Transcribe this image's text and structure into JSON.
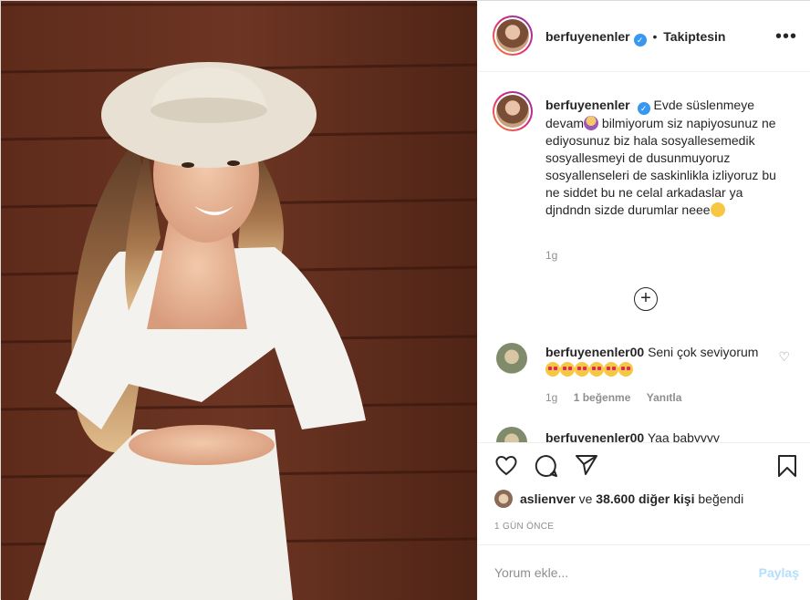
{
  "post": {
    "username": "berfuyenenler",
    "follow_status": "Takiptesin",
    "separator": "•",
    "more_icon": "more-horizontal-icon",
    "caption_parts": [
      "Evde süslenmeye devam",
      " bilmiyorum siz napiyosunuz ne ediyosunuz biz hala sosyallesemedik sosyallesmeyi de dusunmuyoruz sosyallenseleri de saskinlikla izliyoruz bu ne siddet bu ne celal arkadaslar ya djndndn sizde durumlar neee"
    ],
    "caption_time": "1g",
    "load_more_icon": "plus-circle-icon"
  },
  "comments": [
    {
      "username": "berfuyenenler00",
      "text": "Seni çok seviyorum",
      "time": "1g",
      "likes": "1 beğenme",
      "reply": "Yanıtla"
    },
    {
      "username": "berfuyenenler00",
      "text": "Yaa babyyyy"
    }
  ],
  "actions": {
    "like_icon": "heart-icon",
    "comment_icon": "comment-icon",
    "share_icon": "share-icon",
    "save_icon": "bookmark-icon"
  },
  "likes_line": {
    "user": "aslienver",
    "mid": " ve ",
    "count": "38.600 diğer kişi",
    "end": " beğendi"
  },
  "posted_ago": "1 GÜN ÖNCE",
  "add_comment": {
    "placeholder": "Yorum ekle...",
    "post_label": "Paylaş"
  },
  "colors": {
    "verified": "#3897f0",
    "post_button_disabled": "#b2dffc",
    "muted_text": "#8e8e8e"
  }
}
